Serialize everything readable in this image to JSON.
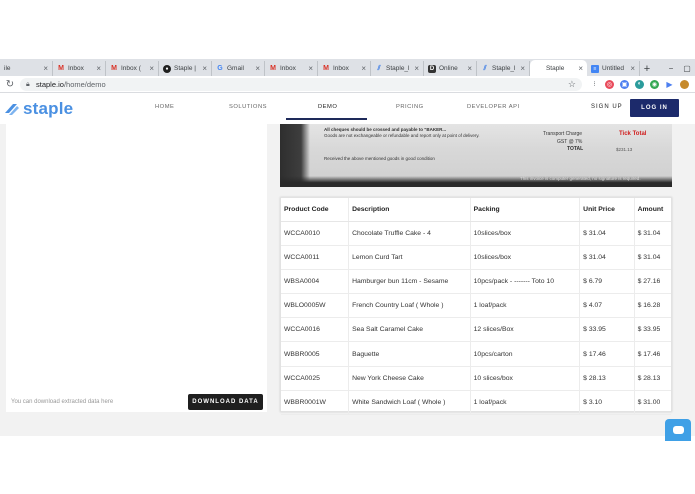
{
  "browser": {
    "tabs": [
      {
        "label": "ile",
        "icon": "generic-tab-icon"
      },
      {
        "label": "Inbox",
        "icon": "gmail-icon"
      },
      {
        "label": "Inbox (",
        "icon": "gmail-icon"
      },
      {
        "label": "Staple |",
        "icon": "github-icon"
      },
      {
        "label": "Gmail",
        "icon": "google-icon"
      },
      {
        "label": "Inbox",
        "icon": "gmail-icon"
      },
      {
        "label": "Inbox",
        "icon": "gmail-icon"
      },
      {
        "label": "Staple_l",
        "icon": "staple-icon"
      },
      {
        "label": "Online",
        "icon": "d-icon"
      },
      {
        "label": "Staple_l",
        "icon": "staple-icon"
      },
      {
        "label": "Staple",
        "icon": "none",
        "active": true
      },
      {
        "label": "Untitled",
        "icon": "docs-icon"
      }
    ],
    "new_tab": "+",
    "url_host": "staple.io",
    "url_path": "/home/demo"
  },
  "site": {
    "logo_text": "staple",
    "nav": {
      "home": "HOME",
      "solutions": "SOLUTIONS",
      "demo": "DEMO",
      "pricing": "PRICING",
      "developer_api": "DEVELOPER API"
    },
    "sign_up": "SIGN UP",
    "log_in": "LOG IN"
  },
  "left_panel": {
    "download_hint": "You can download extracted data here",
    "download_button": "DOWNLOAD DATA"
  },
  "document_preview": {
    "line1": "All cheques should be crossed and payable to \"BAKER...",
    "line2": "Goods are not exchangeable or refundable and report only at point of delivery.",
    "line3": "Received the above mentioned goods in good condition",
    "transport": "Transport Charge",
    "gst": "GST @ 7%",
    "total": "TOTAL",
    "total_value": "$231.13",
    "red_label": "Tick Total",
    "footer": "This invoice is computer generated, no signature is required."
  },
  "table": {
    "headers": [
      "Product Code",
      "Description",
      "Packing",
      "Unit Price",
      "Amount"
    ],
    "rows": [
      [
        "WCCA0010",
        "Chocolate Truffle Cake - 4",
        "10slices/box",
        "$ 31.04",
        "$ 31.04"
      ],
      [
        "WCCA0011",
        "Lemon Curd Tart",
        "10slices/box",
        "$ 31.04",
        "$ 31.04"
      ],
      [
        "WBSA0004",
        "Hamburger bun 11cm - Sesame",
        "10pcs/pack - ------- Toto 10",
        "$ 6.79",
        "$ 27.16"
      ],
      [
        "WBLO0005W",
        "French Country Loaf ( Whole )",
        "1 loaf/pack",
        "$ 4.07",
        "$ 16.28"
      ],
      [
        "WCCA0016",
        "Sea Salt Caramel Cake",
        "12 slices/Box",
        "$ 33.95",
        "$ 33.95"
      ],
      [
        "WBBR0005",
        "Baguette",
        "10pcs/carton",
        "$ 17.46",
        "$ 17.46"
      ],
      [
        "WCCA0025",
        "New York Cheese Cake",
        "10 slices/box",
        "$ 28.13",
        "$ 28.13"
      ],
      [
        "WBBR0001W",
        "White Sandwich Loaf ( Whole )",
        "1 loaf/pack",
        "$ 3.10",
        "$ 31.00"
      ]
    ]
  },
  "colors": {
    "brand_blue": "#4a90e2",
    "login_navy": "#1c2a6b",
    "chat_blue": "#3fa0e6"
  }
}
